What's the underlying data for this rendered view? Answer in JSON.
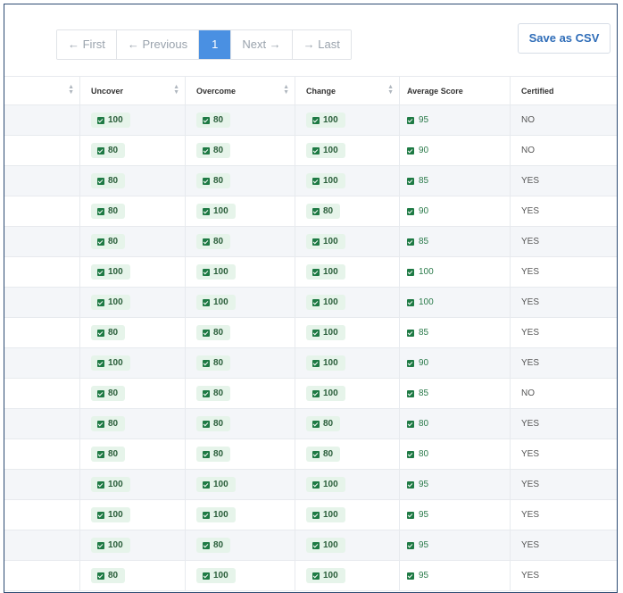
{
  "pagination": {
    "first": "← First",
    "previous": "← Previous",
    "current": "1",
    "next": "Next →",
    "last": "→ Last"
  },
  "actions": {
    "save_csv": "Save as CSV"
  },
  "table": {
    "headers": [
      "Uncover",
      "Overcome",
      "Change",
      "Average Score",
      "Certified"
    ],
    "rows": [
      [
        "100",
        "80",
        "100",
        "95",
        "NO"
      ],
      [
        "80",
        "80",
        "100",
        "90",
        "NO"
      ],
      [
        "80",
        "80",
        "100",
        "85",
        "YES"
      ],
      [
        "80",
        "100",
        "80",
        "90",
        "YES"
      ],
      [
        "80",
        "80",
        "100",
        "85",
        "YES"
      ],
      [
        "100",
        "100",
        "100",
        "100",
        "YES"
      ],
      [
        "100",
        "100",
        "100",
        "100",
        "YES"
      ],
      [
        "80",
        "80",
        "100",
        "85",
        "YES"
      ],
      [
        "100",
        "80",
        "100",
        "90",
        "YES"
      ],
      [
        "80",
        "80",
        "100",
        "85",
        "NO"
      ],
      [
        "80",
        "80",
        "80",
        "80",
        "YES"
      ],
      [
        "80",
        "80",
        "80",
        "80",
        "YES"
      ],
      [
        "100",
        "100",
        "100",
        "95",
        "YES"
      ],
      [
        "100",
        "100",
        "100",
        "95",
        "YES"
      ],
      [
        "100",
        "80",
        "100",
        "95",
        "YES"
      ],
      [
        "80",
        "100",
        "100",
        "95",
        "YES"
      ]
    ]
  },
  "colors": {
    "accent": "#4a90e2",
    "badge_bg": "#e6f4ea",
    "check": "#1e7a44",
    "border": "#2c4a72"
  }
}
